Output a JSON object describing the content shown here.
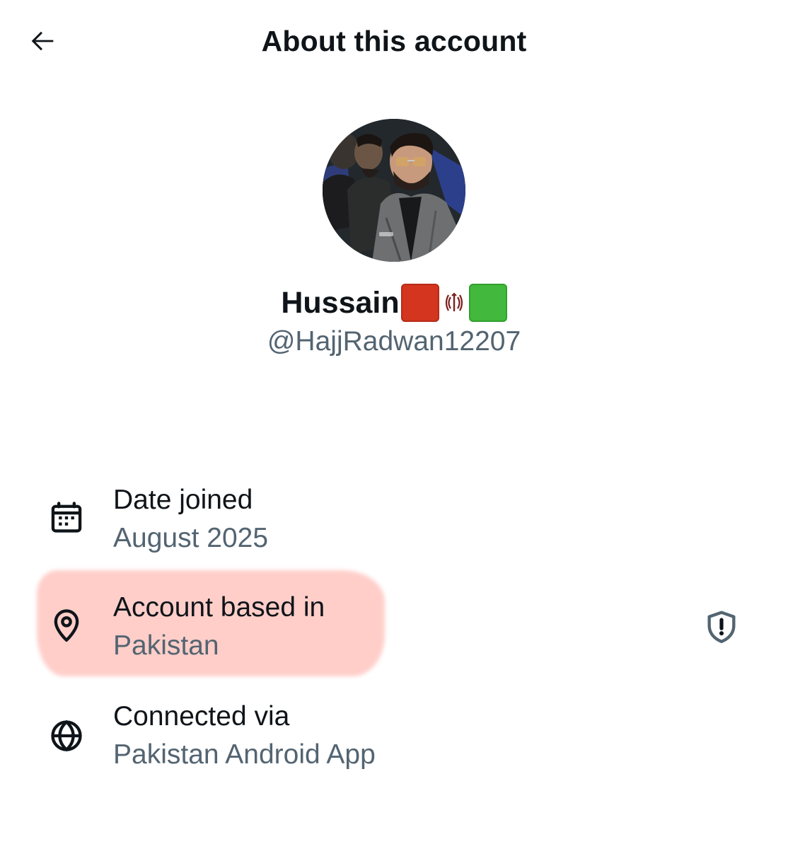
{
  "header": {
    "title": "About this account",
    "back_icon": "arrow-left-icon"
  },
  "profile": {
    "display_name": "Hussain",
    "display_name_emojis": [
      "red-square-emoji",
      "iran-emblem-emoji",
      "green-square-emoji"
    ],
    "handle": "@HajjRadwan12207",
    "avatar_icon": "profile-photo"
  },
  "info": {
    "date_joined": {
      "icon": "calendar-icon",
      "title": "Date joined",
      "value": "August 2025"
    },
    "account_based_in": {
      "icon": "location-pin-icon",
      "title": "Account based in",
      "value": "Pakistan",
      "action_icon": "shield-alert-icon"
    },
    "connected_via": {
      "icon": "globe-icon",
      "title": "Connected via",
      "value": "Pakistan Android App"
    }
  },
  "colors": {
    "text_primary": "#0f1419",
    "text_secondary": "#536471",
    "highlight": "#ffc4be",
    "flag_red": "#d3351f",
    "flag_green": "#42b83d"
  }
}
